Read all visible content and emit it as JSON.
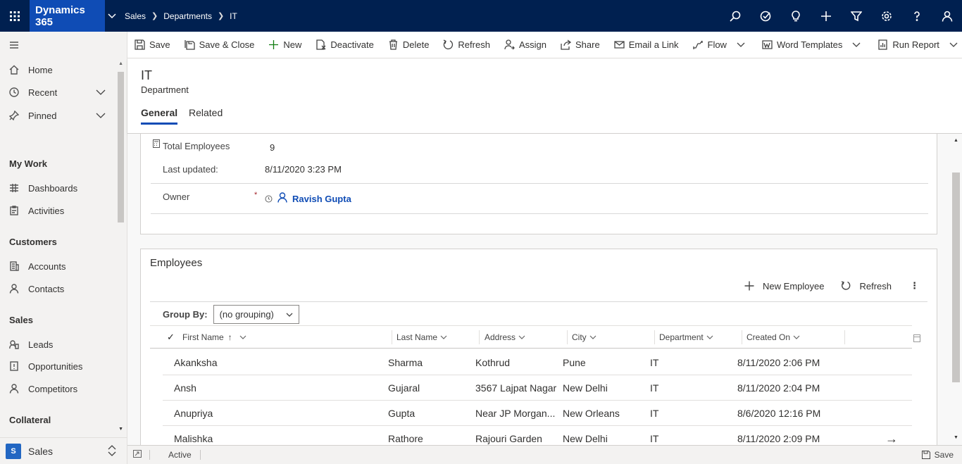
{
  "topbar": {
    "brand": "Dynamics 365",
    "breadcrumbs": [
      "Sales",
      "Departments",
      "IT"
    ],
    "icons": [
      "search-icon",
      "task-icon",
      "lightbulb-icon",
      "plus-icon",
      "filter-icon",
      "gear-icon",
      "help-icon",
      "user-icon"
    ]
  },
  "sidebar": {
    "top_items": [
      {
        "label": "Home",
        "icon": "home-icon"
      },
      {
        "label": "Recent",
        "icon": "clock-icon",
        "expandable": true
      },
      {
        "label": "Pinned",
        "icon": "pin-icon",
        "expandable": true
      }
    ],
    "groups": [
      {
        "title": "My Work",
        "items": [
          {
            "label": "Dashboards",
            "icon": "dashboard-icon"
          },
          {
            "label": "Activities",
            "icon": "clipboard-icon"
          }
        ]
      },
      {
        "title": "Customers",
        "items": [
          {
            "label": "Accounts",
            "icon": "building-icon"
          },
          {
            "label": "Contacts",
            "icon": "person-icon"
          }
        ]
      },
      {
        "title": "Sales",
        "items": [
          {
            "label": "Leads",
            "icon": "phone-icon"
          },
          {
            "label": "Opportunities",
            "icon": "document-icon"
          },
          {
            "label": "Competitors",
            "icon": "person-icon"
          }
        ]
      },
      {
        "title": "Collateral",
        "items": []
      }
    ],
    "area": {
      "badge": "S",
      "label": "Sales"
    }
  },
  "commandbar": {
    "items": [
      {
        "label": "Save",
        "icon": "save-icon"
      },
      {
        "label": "Save & Close",
        "icon": "save-close-icon"
      },
      {
        "label": "New",
        "icon": "plus-icon"
      },
      {
        "label": "Deactivate",
        "icon": "deactivate-icon"
      },
      {
        "label": "Delete",
        "icon": "trash-icon"
      },
      {
        "label": "Refresh",
        "icon": "refresh-icon"
      },
      {
        "label": "Assign",
        "icon": "assign-icon"
      },
      {
        "label": "Share",
        "icon": "share-icon"
      },
      {
        "label": "Email a Link",
        "icon": "email-icon"
      },
      {
        "label": "Flow",
        "icon": "flow-icon",
        "dropdown": true
      },
      {
        "label": "Word Templates",
        "icon": "word-icon",
        "dropdown": true
      },
      {
        "label": "Run Report",
        "icon": "report-icon",
        "dropdown": true
      }
    ]
  },
  "header": {
    "title": "IT",
    "entity": "Department",
    "tabs": [
      "General",
      "Related"
    ],
    "active_tab": "General"
  },
  "summary": {
    "total_employees_label": "Total Employees",
    "total_employees_value": "9",
    "last_updated_label": "Last updated:",
    "last_updated_value": "8/11/2020 3:23 PM",
    "owner_label": "Owner",
    "required_marker": "*",
    "owner_value": "Ravish Gupta"
  },
  "employees": {
    "title": "Employees",
    "new_label": "New Employee",
    "refresh_label": "Refresh",
    "group_by_label": "Group By:",
    "group_by_value": "(no grouping)",
    "columns": [
      "First Name",
      "Last Name",
      "Address",
      "City",
      "Department",
      "Created On"
    ],
    "rows": [
      [
        "Akanksha",
        "Sharma",
        "Kothrud",
        "Pune",
        "IT",
        "8/11/2020 2:06 PM"
      ],
      [
        "Ansh",
        "Gujaral",
        "3567 Lajpat Nagar",
        "New Delhi",
        "IT",
        "8/11/2020 2:04 PM"
      ],
      [
        "Anupriya",
        "Gupta",
        "Near JP Morgan...",
        "New Orleans",
        "IT",
        "8/6/2020 12:16 PM"
      ],
      [
        "Malishka",
        "Rathore",
        "Rajouri Garden",
        "New Delhi",
        "IT",
        "8/11/2020 2:09 PM"
      ]
    ]
  },
  "footer": {
    "status": "Active",
    "save_label": "Save"
  }
}
